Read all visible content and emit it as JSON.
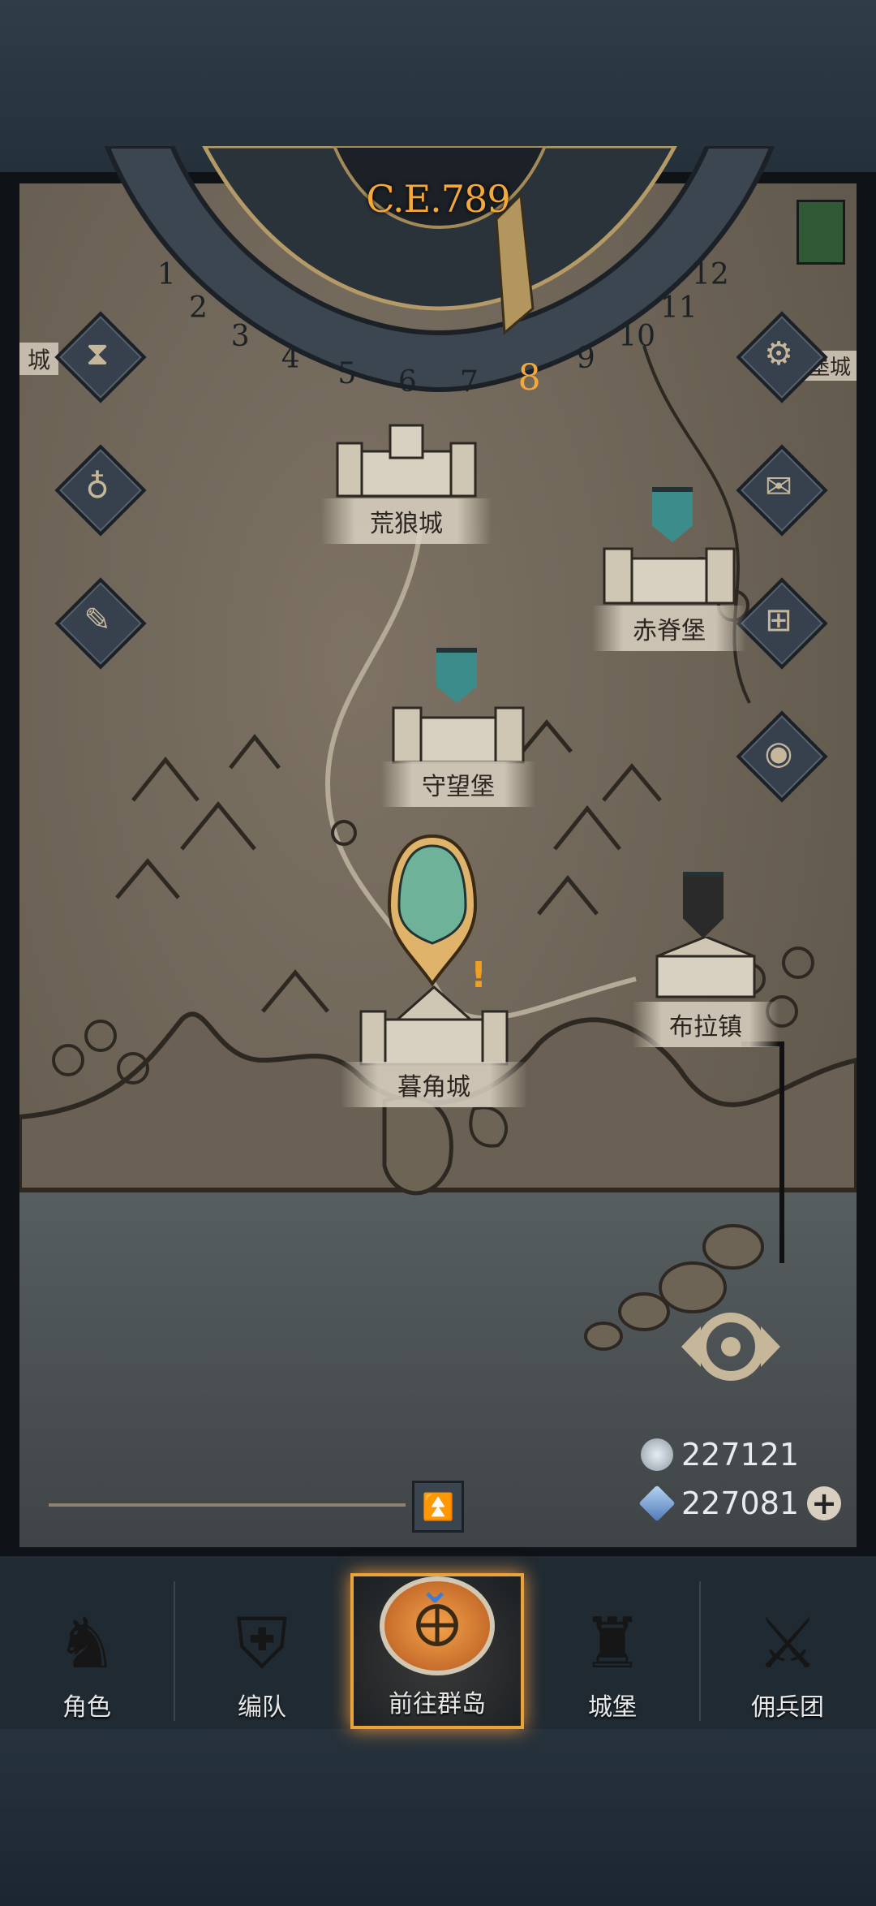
{
  "calendar": {
    "year": "C.E.789",
    "months": [
      "1",
      "2",
      "3",
      "4",
      "5",
      "6",
      "7",
      "8",
      "9",
      "10",
      "11",
      "12"
    ],
    "current_month": "8"
  },
  "cities": [
    {
      "name": "荒狼城"
    },
    {
      "name": "赤脊堡"
    },
    {
      "name": "守望堡"
    },
    {
      "name": "布拉镇"
    },
    {
      "name": "暮角城"
    }
  ],
  "edge_labels": {
    "left": "城",
    "right": "堡城"
  },
  "side_buttons": {
    "left": [
      "hourglass-icon",
      "bag-icon",
      "scroll-icon"
    ],
    "right": [
      "gear-icon",
      "mail-icon",
      "grid-icon",
      "coin-icon"
    ]
  },
  "resources": {
    "silver": "227121",
    "crystal": "227081"
  },
  "tabs": [
    {
      "label": "角色",
      "icon": "knight-icon"
    },
    {
      "label": "编队",
      "icon": "helmet-icon"
    },
    {
      "label": "前往群岛",
      "icon": "globe-icon",
      "active": true
    },
    {
      "label": "城堡",
      "icon": "castle-icon"
    },
    {
      "label": "佣兵团",
      "icon": "mercenary-icon"
    }
  ],
  "colors": {
    "accent": "#f4a73a",
    "banner": "#3d8c8c",
    "active_tab_border": "#e8a43a"
  }
}
